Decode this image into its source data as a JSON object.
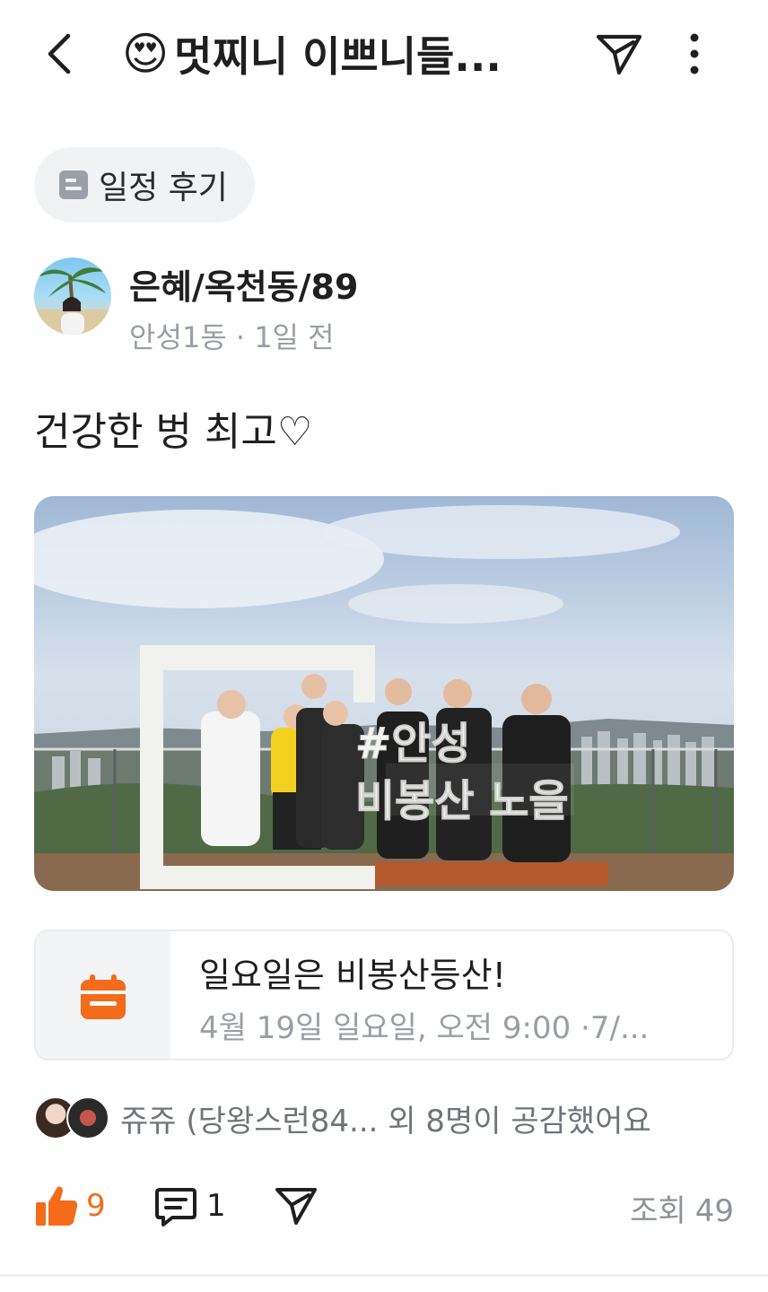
{
  "header": {
    "title_emoji": "😍",
    "title": "멋찌니 이쁘니들..."
  },
  "category_chip": {
    "label": "일정 후기"
  },
  "author": {
    "name": "은혜/옥천동/89",
    "meta": "안성1동 · 1일 전"
  },
  "post": {
    "text": "건강한 벙 최고♡",
    "photo_sign": {
      "line1": "#안성",
      "line2": "비봉산 노을"
    }
  },
  "event": {
    "title": "일요일은 비봉산등산!",
    "meta": "4월 19일 일요일, 오전 9:00 ·7/..."
  },
  "likers": {
    "text": "쥬쥬 (당왕스런84... 외 8명이 공감했어요"
  },
  "actions": {
    "like_count": "9",
    "comment_count": "1",
    "views_label": "조회",
    "views_count": "49"
  },
  "colors": {
    "accent": "#f46b1a",
    "muted": "#9a9ea5",
    "chip_bg": "#f1f2f4"
  }
}
